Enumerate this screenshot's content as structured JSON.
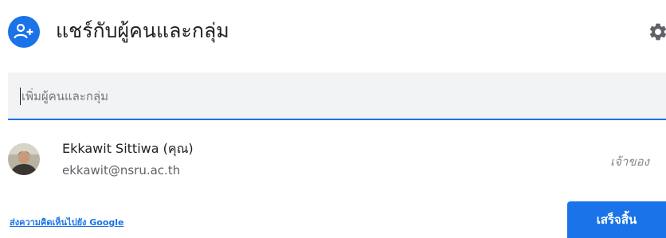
{
  "dialog": {
    "title": "แชร์กับผู้คนและกลุ่ม",
    "header_icon": "add-person-icon",
    "settings_icon": "gear-icon"
  },
  "input": {
    "placeholder": "เพิ่มผู้คนและกลุ่ม"
  },
  "owner": {
    "name": "Ekkawit Sittiwa (คุณ)",
    "email": "ekkawit@nsru.ac.th",
    "role": "เจ้าของ"
  },
  "footer": {
    "feedback_link": "ส่งความคิดเห็นไปยัง Google",
    "done_label": "เสร็จสิ้น"
  },
  "colors": {
    "accent": "#1a73e8",
    "input_bg": "#f1f3f4"
  }
}
